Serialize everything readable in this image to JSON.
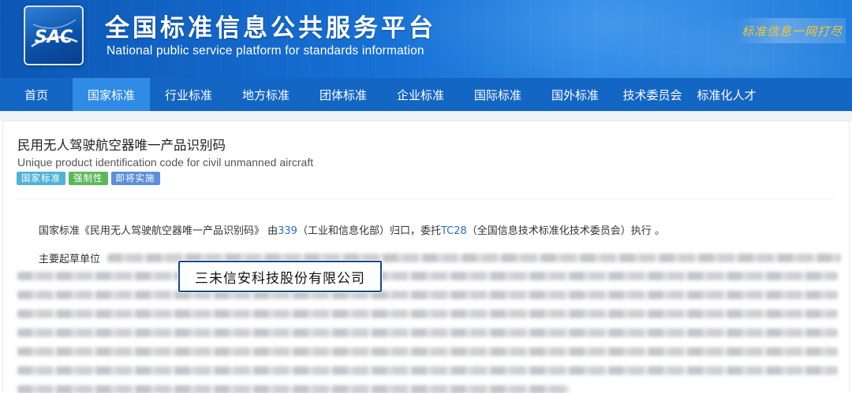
{
  "header": {
    "logo_text": "SAC",
    "title": "全国标准信息公共服务平台",
    "subtitle": "National public service platform  for standards information",
    "slogan": "标准信息一网打尽"
  },
  "nav": {
    "items": [
      {
        "label": "首页"
      },
      {
        "label": "国家标准",
        "active": true
      },
      {
        "label": "行业标准"
      },
      {
        "label": "地方标准"
      },
      {
        "label": "团体标准"
      },
      {
        "label": "企业标准"
      },
      {
        "label": "国际标准"
      },
      {
        "label": "国外标准"
      },
      {
        "label": "技术委员会"
      },
      {
        "label": "标准化人才"
      }
    ]
  },
  "standard": {
    "title": "民用无人驾驶航空器唯一产品识别码",
    "title_en": "Unique product identification code for civil unmanned aircraft",
    "tags": [
      {
        "label": "国家标准",
        "color": "#4fb3d9"
      },
      {
        "label": "强制性",
        "color": "#5cb85c"
      },
      {
        "label": "即将实施",
        "color": "#5b8fd9"
      }
    ],
    "desc_prefix": "国家标准《民用无人驾驶航空器唯一产品识别码》 由",
    "desc_link1": "339",
    "desc_mid": "（工业和信息化部）归口，委托",
    "desc_link2": "TC28",
    "desc_suffix": "（全国信息技术标准化技术委员会）执行 。",
    "drafters_label": "主要起草单位",
    "highlighted_company": "三未信安科技股份有限公司"
  },
  "colors": {
    "header_blue": "#1466c4",
    "nav_active": "#2f8be6",
    "link": "#2a6fc2",
    "highlight_border": "#18487f"
  }
}
